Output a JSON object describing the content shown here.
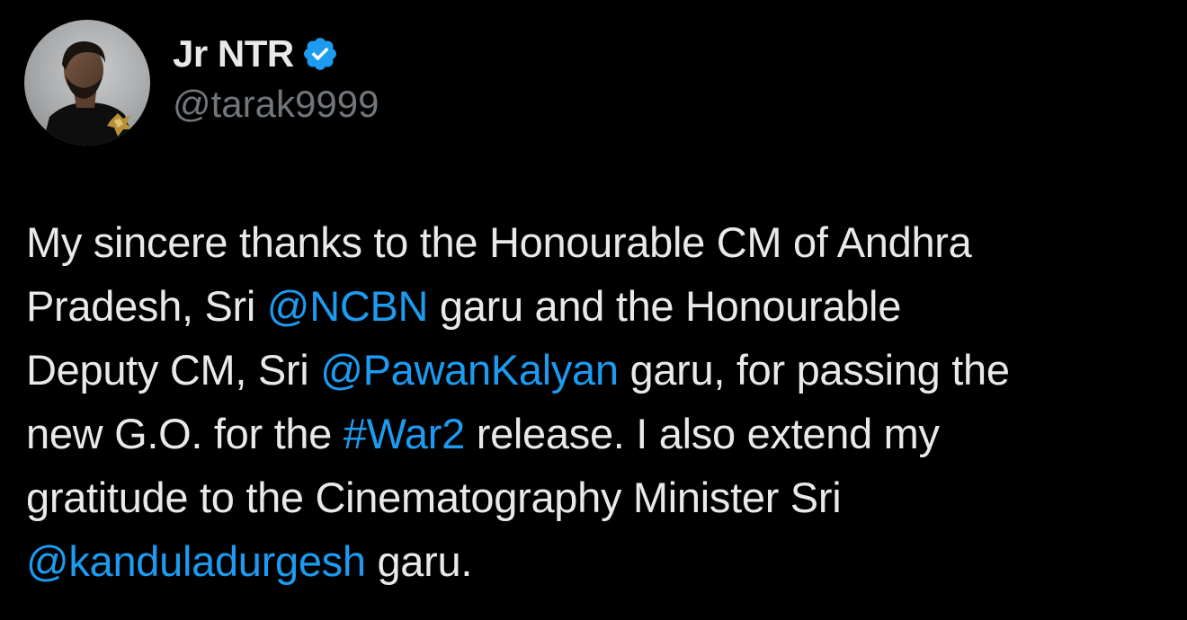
{
  "author": {
    "display_name": "Jr NTR",
    "handle": "@tarak9999",
    "verified": true,
    "verified_icon": "verified-badge-icon",
    "verified_color": "#1d9bf0"
  },
  "tweet": {
    "lines": [
      [
        {
          "text": "My sincere thanks to the Honourable CM of Andhra",
          "link": false
        }
      ],
      [
        {
          "text": "Pradesh, Sri ",
          "link": false
        },
        {
          "text": "@NCBN",
          "link": true
        },
        {
          "text": " garu and the Honourable",
          "link": false
        }
      ],
      [
        {
          "text": "Deputy CM, Sri ",
          "link": false
        },
        {
          "text": "@PawanKalyan",
          "link": true
        },
        {
          "text": " garu, for passing the",
          "link": false
        }
      ],
      [
        {
          "text": "new G.O. for the ",
          "link": false
        },
        {
          "text": "#War2",
          "link": true
        },
        {
          "text": " release. I also extend my",
          "link": false
        }
      ],
      [
        {
          "text": "gratitude to the Cinematography Minister Sri",
          "link": false
        }
      ],
      [
        {
          "text": "@kanduladurgesh",
          "link": true
        },
        {
          "text": " garu.",
          "link": false
        }
      ]
    ]
  },
  "colors": {
    "background": "#000000",
    "text": "#e7e9ea",
    "secondary_text": "#71767b",
    "link": "#1d9bf0"
  }
}
